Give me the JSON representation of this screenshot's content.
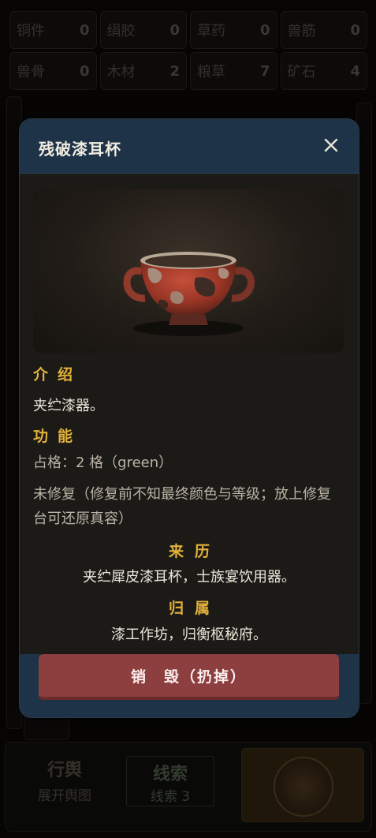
{
  "resources": [
    {
      "name": "铜件",
      "value": "0"
    },
    {
      "name": "绢胶",
      "value": "0"
    },
    {
      "name": "草药",
      "value": "0"
    },
    {
      "name": "兽筋",
      "value": "0"
    },
    {
      "name": "兽骨",
      "value": "0"
    },
    {
      "name": "木材",
      "value": "2"
    },
    {
      "name": "粮草",
      "value": "7"
    },
    {
      "name": "矿石",
      "value": "4"
    }
  ],
  "bottom_nav": {
    "map_label": "行舆",
    "map_sub": "展开舆图",
    "clue_label": "线索",
    "clue_sub": "线索 3"
  },
  "dialog": {
    "title": "残破漆耳杯",
    "close_icon": "close-icon",
    "intro_heading": "介绍",
    "intro_text": "夹纻漆器。",
    "function_heading": "功能",
    "function_slots": "占格：2 格（green）",
    "repair_note": "未修复（修复前不知最终颜色与等级；放上修复台可还原真容）",
    "origin_heading": "来历",
    "origin_text": "夹纻犀皮漆耳杯，士族宴饮用器。",
    "owner_heading": "归属",
    "owner_text": "漆工作坊，归衡枢秘府。",
    "destroy_label": "销　毁（扔掉）"
  },
  "colors": {
    "accent_gold": "#e2b13a",
    "header_blue": "#1e3347",
    "destroy_red": "#8d3e3e"
  }
}
